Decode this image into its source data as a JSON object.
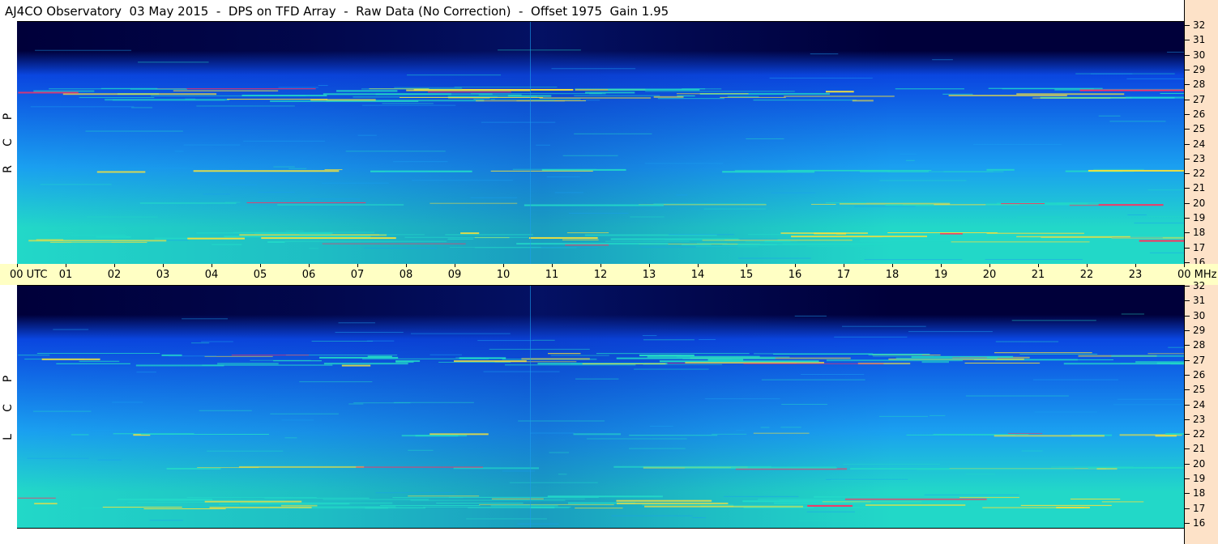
{
  "title": "AJ4CO Observatory  03 May 2015  -  DPS on TFD Array  -  Raw Data (No Correction)  -  Offset 1975  Gain 1.95",
  "panels": [
    {
      "id": "rcp",
      "letters": [
        "R",
        "C",
        "P"
      ]
    },
    {
      "id": "lcp",
      "letters": [
        "L",
        "C",
        "P"
      ]
    }
  ],
  "time_axis": {
    "first_label": "00 UTC",
    "labels": [
      "01",
      "02",
      "03",
      "04",
      "05",
      "06",
      "07",
      "08",
      "09",
      "10",
      "11",
      "12",
      "13",
      "14",
      "15",
      "16",
      "17",
      "18",
      "19",
      "20",
      "21",
      "22",
      "23"
    ],
    "last_label": "00 MHz"
  },
  "freq_axis": {
    "labels": [
      "32",
      "31",
      "30",
      "29",
      "28",
      "27",
      "26",
      "25",
      "24",
      "23",
      "22",
      "21",
      "20",
      "19",
      "18",
      "17",
      "16"
    ]
  },
  "colors": {
    "low": "#00003a",
    "mid_low": "#0a46e0",
    "mid": "#1aa0f0",
    "mid_high": "#22d8c8",
    "high": "#f0e040",
    "peak": "#ff3060"
  },
  "chart_data": {
    "type": "heatmap",
    "x_range_utc_hours": [
      0,
      24
    ],
    "y_range_mhz": [
      16,
      32
    ],
    "series": [
      {
        "name": "RCP"
      },
      {
        "name": "LCP"
      }
    ],
    "bright_bands_mhz": [
      27.2,
      17.7,
      20.0,
      22.2
    ],
    "legend": "none"
  }
}
